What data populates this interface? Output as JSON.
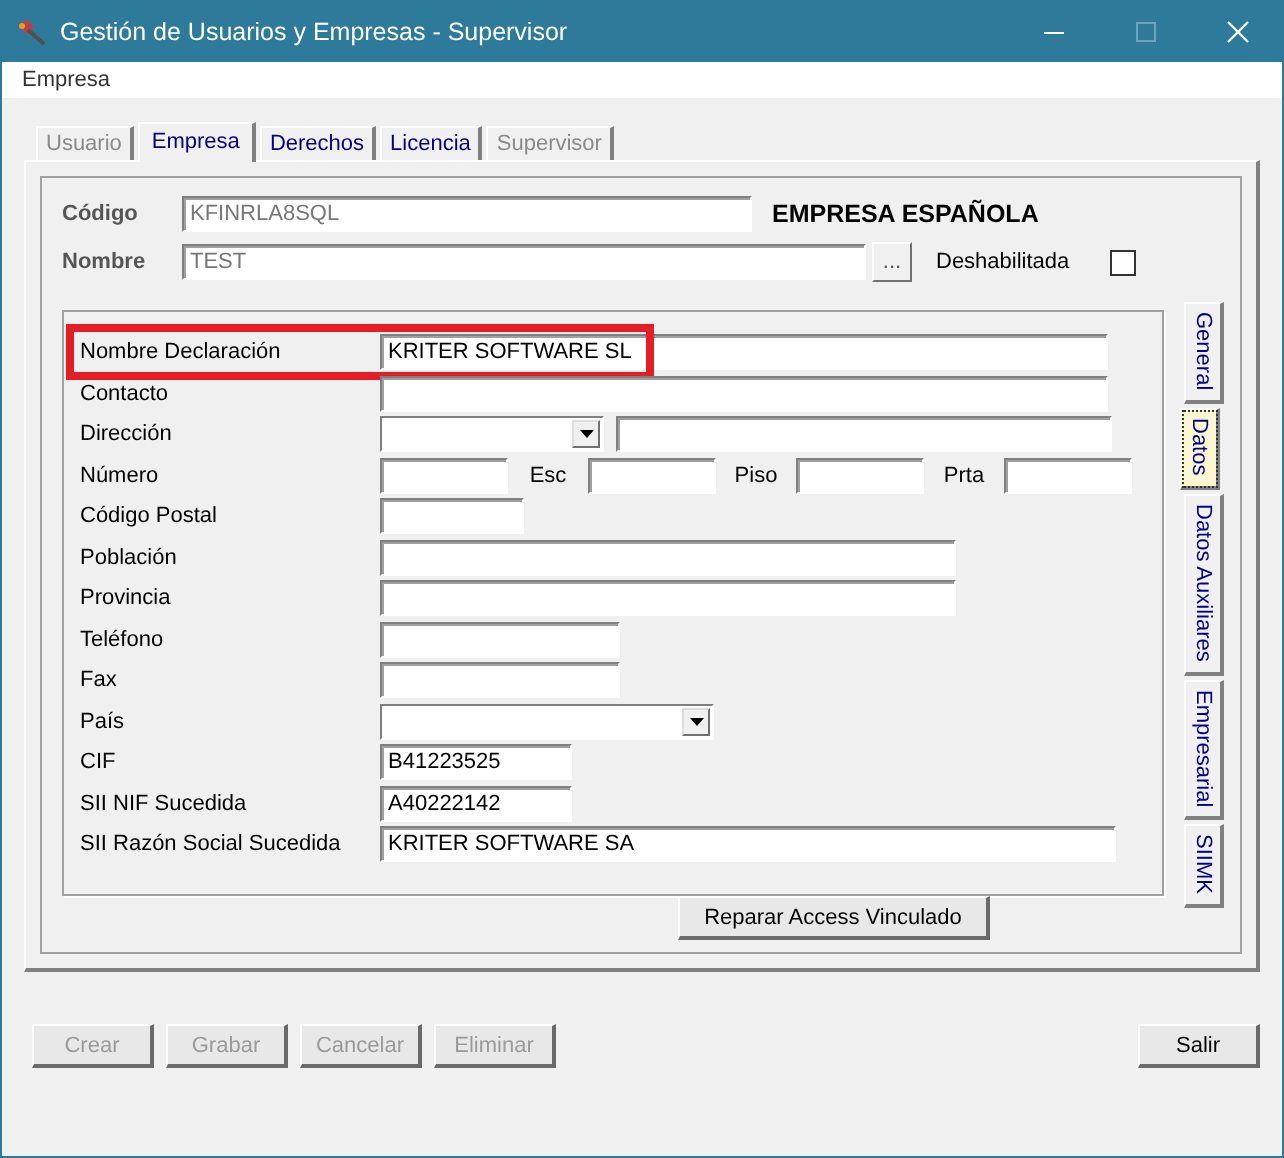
{
  "window": {
    "title": "Gestión de Usuarios y Empresas - Supervisor"
  },
  "menu": [
    "Empresa"
  ],
  "tabs": [
    {
      "label": "Usuario",
      "selected": false,
      "disabled": true
    },
    {
      "label": "Empresa",
      "selected": true,
      "disabled": false
    },
    {
      "label": "Derechos",
      "selected": false,
      "disabled": false
    },
    {
      "label": "Licencia",
      "selected": false,
      "disabled": false
    },
    {
      "label": "Supervisor",
      "selected": false,
      "disabled": true
    }
  ],
  "header": {
    "codigo_label": "Código",
    "codigo_value": "KFINRLA8SQL",
    "company_name": "EMPRESA ESPAÑOLA",
    "nombre_label": "Nombre",
    "nombre_value": "TEST",
    "browse_button": "...",
    "disabled_label": "Deshabilitada",
    "disabled_checked": false
  },
  "fields": [
    {
      "label": "Nombre Declaración",
      "kind": "text",
      "value": "KRITER SOFTWARE SL",
      "highlighted": true
    },
    {
      "label": "Contacto",
      "kind": "text",
      "highlighted": false
    },
    {
      "label": "Dirección",
      "kind": "address",
      "highlighted": false
    },
    {
      "label": "Número",
      "kind": "number",
      "sub_labels": [
        "Esc",
        "Piso",
        "Prta"
      ],
      "highlighted": false
    },
    {
      "label": "Código Postal",
      "kind": "text",
      "highlighted": false
    },
    {
      "label": "Población",
      "kind": "text",
      "highlighted": false
    },
    {
      "label": "Provincia",
      "kind": "text",
      "highlighted": false
    },
    {
      "label": "Teléfono",
      "kind": "text",
      "highlighted": false
    },
    {
      "label": "Fax",
      "kind": "text",
      "highlighted": false
    },
    {
      "label": "País",
      "kind": "combo",
      "highlighted": false
    },
    {
      "label": "CIF",
      "kind": "text",
      "value": "B41223525",
      "highlighted": false
    },
    {
      "label": "SII NIF Sucedida",
      "kind": "text",
      "value": "A40222142",
      "highlighted": false
    },
    {
      "label": "SII Razón Social Sucedida",
      "kind": "text",
      "value": "KRITER SOFTWARE SA",
      "highlighted": false
    }
  ],
  "side_tabs": [
    {
      "label": "General",
      "selected": false
    },
    {
      "label": "Datos",
      "selected": true
    },
    {
      "label": "Datos Auxiliares",
      "selected": false
    },
    {
      "label": "Empresarial",
      "selected": false
    },
    {
      "label": "SIIMK",
      "selected": false
    }
  ],
  "repair_button": "Reparar Access Vinculado",
  "buttons": [
    {
      "label": "Crear",
      "disabled": true
    },
    {
      "label": "Grabar",
      "disabled": true
    },
    {
      "label": "Cancelar",
      "disabled": true
    },
    {
      "label": "Eliminar",
      "disabled": true
    },
    {
      "label": "Salir",
      "disabled": false
    }
  ]
}
